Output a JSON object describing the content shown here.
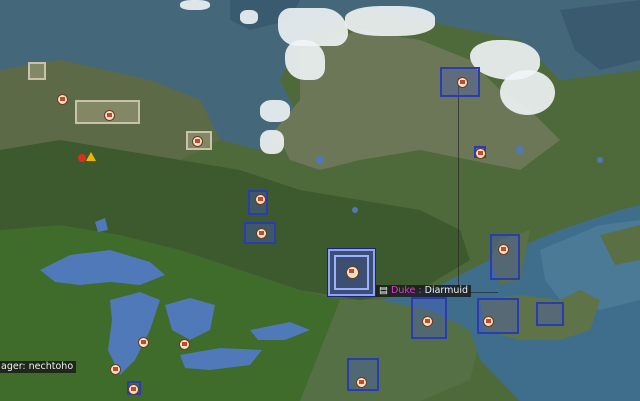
{
  "player_tag": {
    "icon": "chest-icon",
    "rank": "Duke",
    "separator": ":",
    "name": "Diarmuid"
  },
  "villager_tag": {
    "text": "ager: nechtoho"
  },
  "colors": {
    "claim_border": "#2b3bb0",
    "claim_fill": "#4a5ac8",
    "grey_claim": "#c9c2a8",
    "water": "#3f6d8c",
    "forest": "#3a5a2e",
    "accent": "#e23ad6"
  }
}
